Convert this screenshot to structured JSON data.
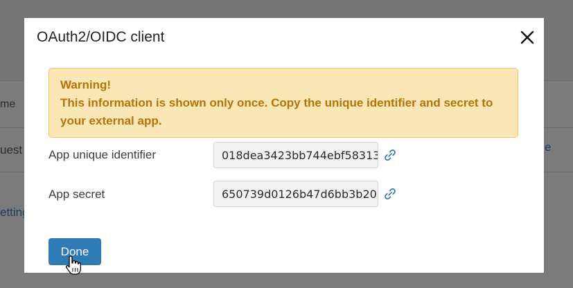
{
  "background": {
    "col_header": "me",
    "row_text": "uest",
    "right_fragment": "e",
    "settings_link": "etting"
  },
  "modal": {
    "title": "OAuth2/OIDC client",
    "warning": {
      "heading": "Warning!",
      "message": "This information is shown only once. Copy the unique identifier and secret to your external app."
    },
    "fields": {
      "app_id_label": "App unique identifier",
      "app_id_value": "018dea3423bb744ebf58313",
      "app_secret_label": "App secret",
      "app_secret_value": "650739d0126b47d6bb3b20"
    },
    "done_label": "Done"
  },
  "colors": {
    "primary": "#2f7bb5",
    "warning_bg": "#fbe6b6",
    "warning_text": "#b47409",
    "link_icon": "#3b78ae"
  },
  "icons": {
    "close": "close-icon",
    "copy_link": "link-icon",
    "pointer": "hand-cursor-icon"
  }
}
